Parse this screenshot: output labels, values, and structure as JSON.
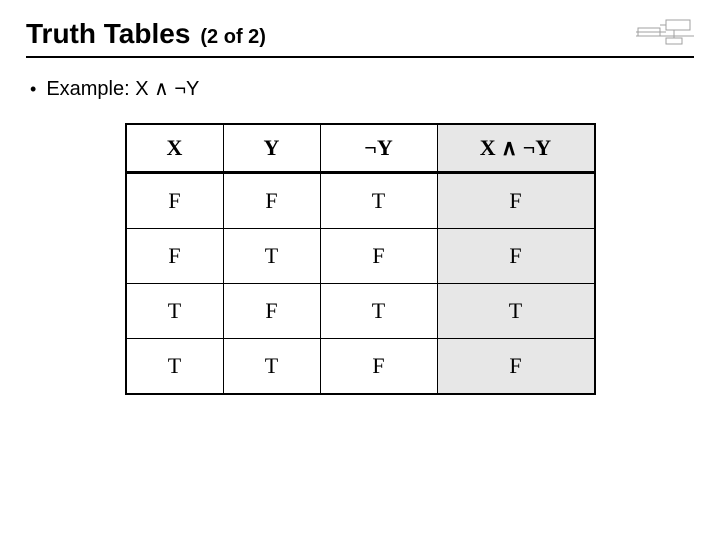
{
  "header": {
    "title": "Truth Tables",
    "suffix": "(2 of 2)",
    "icon_name": "computer-diagram-icon"
  },
  "bullet": {
    "label": "Example: X ∧ ¬Y"
  },
  "table": {
    "headers": {
      "x": "X",
      "y": "Y",
      "not_y": "¬Y",
      "result": "X ∧ ¬Y"
    },
    "rows": [
      {
        "x": "F",
        "y": "F",
        "not_y": "T",
        "result": "F"
      },
      {
        "x": "F",
        "y": "T",
        "not_y": "F",
        "result": "F"
      },
      {
        "x": "T",
        "y": "F",
        "not_y": "T",
        "result": "T"
      },
      {
        "x": "T",
        "y": "T",
        "not_y": "F",
        "result": "F"
      }
    ]
  }
}
